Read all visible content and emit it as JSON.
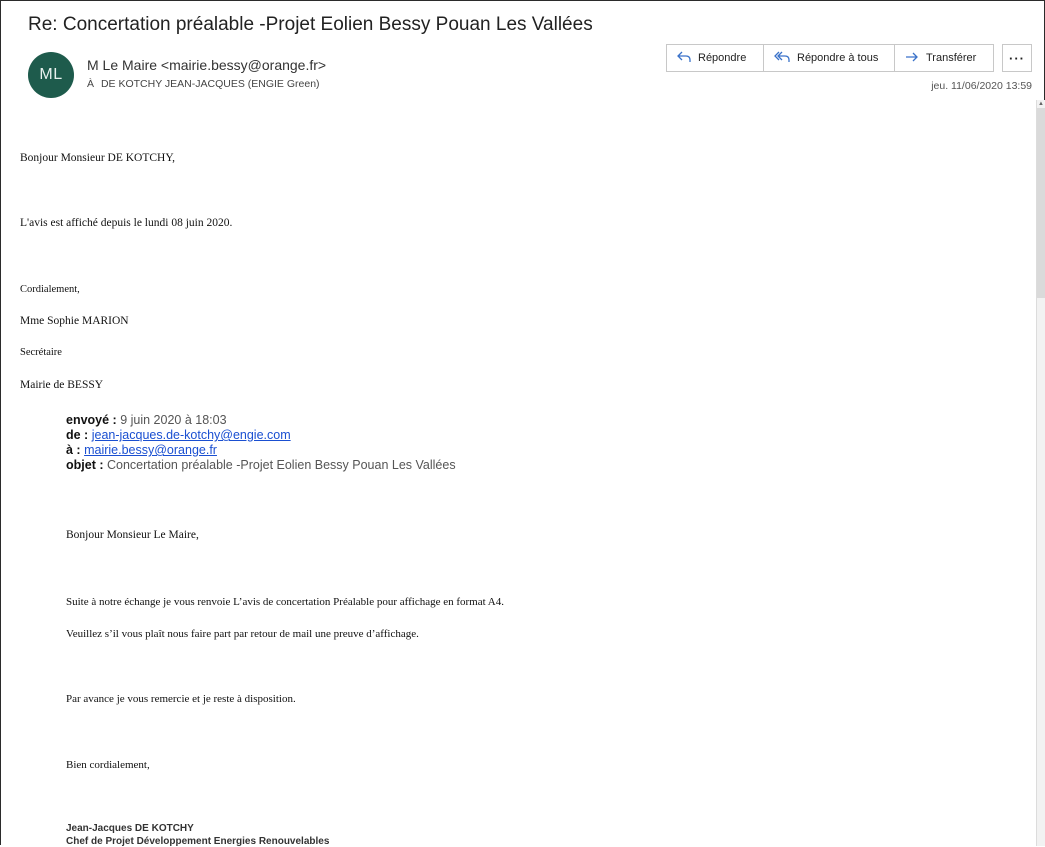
{
  "email": {
    "subject": "Re: Concertation préalable -Projet Eolien Bessy Pouan Les Vallées",
    "avatar_initials": "ML",
    "sender": "M Le Maire <mairie.bessy@orange.fr>",
    "to_prefix": "À",
    "to": "DE KOTCHY JEAN-JACQUES (ENGIE Green)",
    "date": "jeu. 11/06/2020 13:59"
  },
  "toolbar": {
    "reply": "Répondre",
    "reply_all": "Répondre à tous",
    "forward": "Transférer",
    "more": "···"
  },
  "body": {
    "greeting": "Bonjour Monsieur DE KOTCHY,",
    "line1": "L'avis est affiché depuis le lundi 08 juin 2020.",
    "closing": "Cordialement,",
    "name": "Mme Sophie MARION",
    "role": "Secrétaire",
    "org": "Mairie de BESSY"
  },
  "quoted": {
    "sent_label": "envoyé :",
    "sent_value": "9 juin 2020 à 18:03",
    "from_label": "de :",
    "from_value": "jean-jacques.de-kotchy@engie.com",
    "to_label": "à :",
    "to_value": "mairie.bessy@orange.fr",
    "subject_label": "objet :",
    "subject_value": "Concertation préalable -Projet Eolien Bessy Pouan Les Vallées",
    "greeting": "Bonjour Monsieur Le Maire,",
    "line1": "Suite à notre échange je vous renvoie L’avis de concertation Préalable pour affichage en format A4.",
    "line2": "Veuillez s’il  vous plaît nous faire  part par retour de mail une preuve d’affichage.",
    "line3": "Par avance je vous remercie et je reste à disposition.",
    "closing": "Bien cordialement,",
    "sig_name": "Jean-Jacques DE KOTCHY",
    "sig_title": "Chef de Projet Développement Energies Renouvelables"
  },
  "colors": {
    "avatar_bg": "#1e5b4c",
    "accent_icon": "#3a72c9",
    "link": "#1a4fd1"
  },
  "icons": {
    "reply": "reply-arrow-icon",
    "reply_all": "reply-all-arrow-icon",
    "forward": "forward-arrow-icon",
    "more": "ellipsis-icon"
  }
}
